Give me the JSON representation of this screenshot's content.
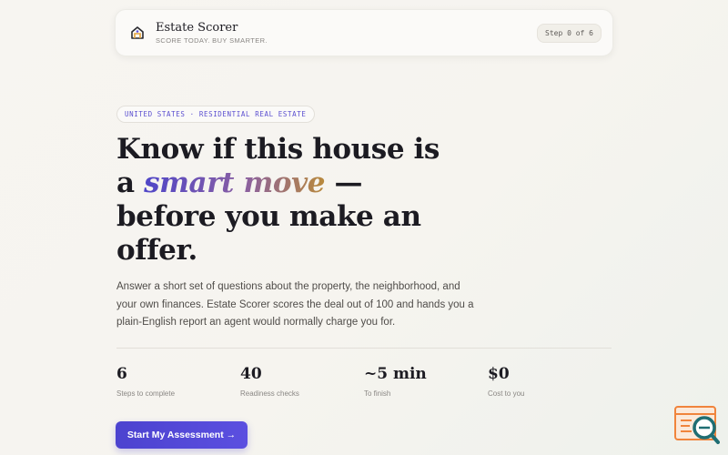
{
  "header": {
    "brand_name": "Estate Scorer",
    "tagline": "SCORE TODAY. BUY SMARTER.",
    "step_indicator": "Step 0 of 6",
    "logo_icon": "house-logo-icon"
  },
  "hero": {
    "eyebrow": "UNITED STATES · RESIDENTIAL REAL ESTATE",
    "headline_line1": "Know if this house is",
    "headline_a": "a",
    "headline_accent": "smart move",
    "headline_dash": "—",
    "headline_line3": "before you make an offer.",
    "lede": "Answer a short set of questions about the property, the neighborhood, and your own finances. Estate Scorer scores the deal out of 100 and hands you a plain-English report an agent would normally charge you for."
  },
  "stats": [
    {
      "value": "6",
      "label": "Steps to complete"
    },
    {
      "value": "40",
      "label": "Readiness checks"
    },
    {
      "value": "~5 min",
      "label": "To finish"
    },
    {
      "value": "$0",
      "label": "Cost to you"
    }
  ],
  "cta": {
    "label": "Start My Assessment →"
  },
  "colors": {
    "accent": "#5b4fe0",
    "accent_gradient_end": "#b8893c",
    "helper_orange": "#f0843c",
    "helper_teal": "#1f6e73"
  },
  "helper_widget": {
    "icon": "search-document-helper-icon"
  }
}
